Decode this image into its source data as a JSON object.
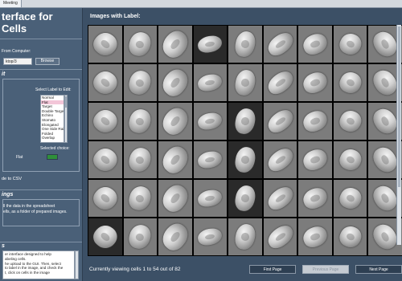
{
  "topbar": {
    "tab_label": "Meeting"
  },
  "sidebar": {
    "title_line1": "terface for",
    "title_line2": "Cells",
    "load": {
      "label": "From Computer:",
      "file_value": "ktop/3",
      "browse_label": "Browse"
    },
    "edit": {
      "heading": "it",
      "select_label": "Select Label to Edit:",
      "options": [
        "Normal",
        "Flat",
        "Target",
        "Double Target",
        "Echino",
        "Stomato",
        "Elongated",
        "One Side Raised",
        "Folded",
        "Overlap"
      ],
      "selected_index": 1,
      "selected_choice_label": "Selected choice:",
      "selected_choice_value": "Flat",
      "selected_color": "#2f8f3a",
      "save_label": "de to CSV"
    },
    "settings": {
      "heading": "ings",
      "line1": "ll the data in the spreadsheet",
      "line2": "ells, as a folder of prepared images."
    },
    "notes": {
      "heading": "s",
      "line1": "er interface designed to help",
      "line2": "abeling cells.",
      "line3": "he upload to the GUI. Then, select",
      "line4": "to label in the image, and check the",
      "line5": "t, click on cells in the image"
    }
  },
  "main": {
    "images_title": "Images with Label:",
    "status_text": "Currently viewing cells 1 to 54 out of 82",
    "first_page_label": "First Page",
    "previous_page_label": "Previous Page",
    "next_page_label": "Next Page",
    "grid": {
      "rows": 6,
      "cols": 9
    }
  }
}
